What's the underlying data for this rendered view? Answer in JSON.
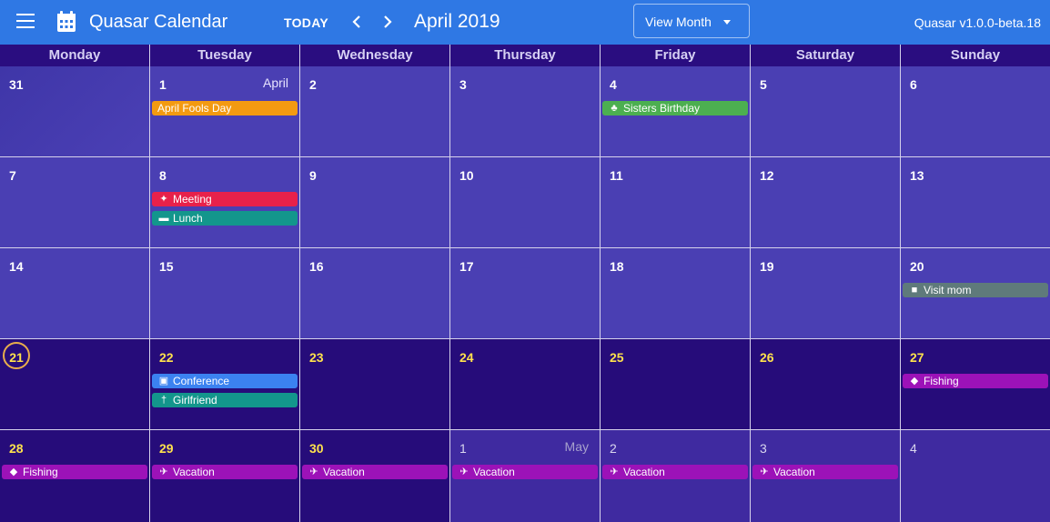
{
  "app": {
    "title": "Quasar Calendar",
    "today_label": "TODAY",
    "month_label": "April 2019",
    "view_select": "View Month",
    "version": "Quasar v1.0.0-beta.18"
  },
  "weekdays": [
    "Monday",
    "Tuesday",
    "Wednesday",
    "Thursday",
    "Friday",
    "Saturday",
    "Sunday"
  ],
  "colors": {
    "toolbar": "#2f78e4",
    "header": "#2a0d80",
    "past_cell": "#4a3fb3",
    "future_cell": "#260c7a",
    "next_month_cell": "#3f2aa0",
    "today_ring": "#e8ad4c",
    "future_daynum": "#ffe24d"
  },
  "weeks": [
    {
      "days": [
        {
          "num": "31",
          "kind": "past"
        },
        {
          "num": "1",
          "month": "April",
          "kind": "past",
          "events": [
            {
              "label": "April Fools Day",
              "color": "#f39a11"
            }
          ]
        },
        {
          "num": "2",
          "kind": "past"
        },
        {
          "num": "3",
          "kind": "past"
        },
        {
          "num": "4",
          "kind": "past",
          "events": [
            {
              "label": "Sisters Birthday",
              "color": "#4caf50",
              "icon": "cake-icon"
            }
          ]
        },
        {
          "num": "5",
          "kind": "past"
        },
        {
          "num": "6",
          "kind": "past"
        }
      ]
    },
    {
      "days": [
        {
          "num": "7",
          "kind": "past"
        },
        {
          "num": "8",
          "kind": "past",
          "events": [
            {
              "label": "Meeting",
              "color": "#e8214a",
              "icon": "handshake-icon"
            },
            {
              "label": "Lunch",
              "color": "#13968c",
              "icon": "burger-icon"
            }
          ]
        },
        {
          "num": "9",
          "kind": "past"
        },
        {
          "num": "10",
          "kind": "past"
        },
        {
          "num": "11",
          "kind": "past"
        },
        {
          "num": "12",
          "kind": "past"
        },
        {
          "num": "13",
          "kind": "past"
        }
      ]
    },
    {
      "days": [
        {
          "num": "14",
          "kind": "past"
        },
        {
          "num": "15",
          "kind": "past"
        },
        {
          "num": "16",
          "kind": "past"
        },
        {
          "num": "17",
          "kind": "past"
        },
        {
          "num": "18",
          "kind": "past"
        },
        {
          "num": "19",
          "kind": "past"
        },
        {
          "num": "20",
          "kind": "past",
          "events": [
            {
              "label": "Visit mom",
              "color": "#5f7a7b",
              "icon": "car-icon"
            }
          ]
        }
      ]
    },
    {
      "days": [
        {
          "num": "21",
          "kind": "today"
        },
        {
          "num": "22",
          "kind": "future",
          "events": [
            {
              "label": "Conference",
              "color": "#3b82f0",
              "icon": "presentation-icon"
            },
            {
              "label": "Girlfriend",
              "color": "#13968c",
              "icon": "utensils-icon"
            }
          ]
        },
        {
          "num": "23",
          "kind": "future"
        },
        {
          "num": "24",
          "kind": "future"
        },
        {
          "num": "25",
          "kind": "future"
        },
        {
          "num": "26",
          "kind": "future"
        },
        {
          "num": "27",
          "kind": "future",
          "events": [
            {
              "label": "Fishing",
              "color": "#9c12b8",
              "icon": "fish-icon"
            }
          ]
        }
      ]
    },
    {
      "days": [
        {
          "num": "28",
          "kind": "future",
          "events": [
            {
              "label": "Fishing",
              "color": "#9c12b8",
              "icon": "fish-icon"
            }
          ]
        },
        {
          "num": "29",
          "kind": "future",
          "events": [
            {
              "label": "Vacation",
              "color": "#9c12b8",
              "icon": "plane-icon"
            }
          ]
        },
        {
          "num": "30",
          "kind": "future",
          "events": [
            {
              "label": "Vacation",
              "color": "#9c12b8",
              "icon": "plane-icon"
            }
          ]
        },
        {
          "num": "1",
          "month": "May",
          "kind": "next",
          "events": [
            {
              "label": "Vacation",
              "color": "#9c12b8",
              "icon": "plane-icon"
            }
          ]
        },
        {
          "num": "2",
          "kind": "next",
          "events": [
            {
              "label": "Vacation",
              "color": "#9c12b8",
              "icon": "plane-icon"
            }
          ]
        },
        {
          "num": "3",
          "kind": "next",
          "events": [
            {
              "label": "Vacation",
              "color": "#9c12b8",
              "icon": "plane-icon"
            }
          ]
        },
        {
          "num": "4",
          "kind": "next"
        }
      ]
    }
  ]
}
